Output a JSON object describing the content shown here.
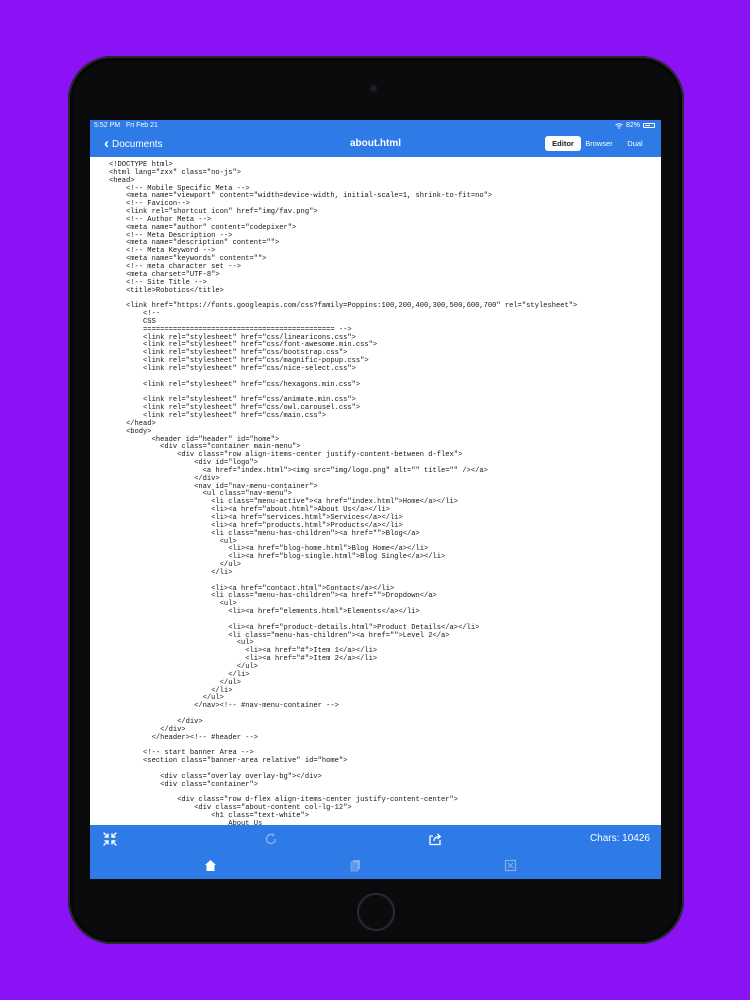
{
  "status_bar": {
    "time": "5:52 PM",
    "date": "Fri Feb 21",
    "battery": "82%"
  },
  "nav_bar": {
    "back_label": "Documents",
    "title": "about.html",
    "modes": [
      {
        "label": "Editor",
        "active": true
      },
      {
        "label": "Browser",
        "active": false
      },
      {
        "label": "Dual",
        "active": false
      }
    ]
  },
  "editor": {
    "code_lines": [
      "<!DOCTYPE html>",
      "<html lang=\"zxx\" class=\"no-js\">",
      "<head>",
      "    <!-- Mobile Specific Meta -->",
      "    <meta name=\"viewport\" content=\"width=device-width, initial-scale=1, shrink-to-fit=no\">",
      "    <!-- Favicon-->",
      "    <link rel=\"shortcut icon\" href=\"img/fav.png\">",
      "    <!-- Author Meta -->",
      "    <meta name=\"author\" content=\"codepixer\">",
      "    <!-- Meta Description -->",
      "    <meta name=\"description\" content=\"\">",
      "    <!-- Meta Keyword -->",
      "    <meta name=\"keywords\" content=\"\">",
      "    <!-- meta character set -->",
      "    <meta charset=\"UTF-8\">",
      "    <!-- Site Title -->",
      "    <title>Robotics</title>",
      "",
      "    <link href=\"https://fonts.googleapis.com/css?family=Poppins:100,200,400,300,500,600,700\" rel=\"stylesheet\">",
      "        <!--",
      "        CSS",
      "        ============================================= -->",
      "        <link rel=\"stylesheet\" href=\"css/linearicons.css\">",
      "        <link rel=\"stylesheet\" href=\"css/font-awesome.min.css\">",
      "        <link rel=\"stylesheet\" href=\"css/bootstrap.css\">",
      "        <link rel=\"stylesheet\" href=\"css/magnific-popup.css\">",
      "        <link rel=\"stylesheet\" href=\"css/nice-select.css\">",
      "",
      "        <link rel=\"stylesheet\" href=\"css/hexagons.min.css\">",
      "",
      "        <link rel=\"stylesheet\" href=\"css/animate.min.css\">",
      "        <link rel=\"stylesheet\" href=\"css/owl.carousel.css\">",
      "        <link rel=\"stylesheet\" href=\"css/main.css\">",
      "    </head>",
      "    <body>",
      "          <header id=\"header\" id=\"home\">",
      "            <div class=\"container main-menu\">",
      "                <div class=\"row align-items-center justify-content-between d-flex\">",
      "                    <div id=\"logo\">",
      "                      <a href=\"index.html\"><img src=\"img/logo.png\" alt=\"\" title=\"\" /></a>",
      "                    </div>",
      "                    <nav id=\"nav-menu-container\">",
      "                      <ul class=\"nav-menu\">",
      "                        <li class=\"menu-active\"><a href=\"index.html\">Home</a></li>",
      "                        <li><a href=\"about.html\">About Us</a></li>",
      "                        <li><a href=\"services.html\">Services</a></li>",
      "                        <li><a href=\"products.html\">Products</a></li>",
      "                        <li class=\"menu-has-children\"><a href=\"\">Blog</a>",
      "                          <ul>",
      "                            <li><a href=\"blog-home.html\">Blog Home</a></li>",
      "                            <li><a href=\"blog-single.html\">Blog Single</a></li>",
      "                          </ul>",
      "                        </li>",
      "",
      "                        <li><a href=\"contact.html\">Contact</a></li>",
      "                        <li class=\"menu-has-children\"><a href=\"\">Dropdown</a>",
      "                          <ul>",
      "                            <li><a href=\"elements.html\">Elements</a></li>",
      "",
      "                            <li><a href=\"product-details.html\">Product Details</a></li>",
      "                            <li class=\"menu-has-children\"><a href=\"\">Level 2</a>",
      "                              <ul>",
      "                                <li><a href=\"#\">Item 1</a></li>",
      "                                <li><a href=\"#\">Item 2</a></li>",
      "                              </ul>",
      "                            </li>",
      "                          </ul>",
      "                        </li>",
      "                      </ul>",
      "                    </nav><!-- #nav-menu-container -->",
      "",
      "                </div>",
      "            </div>",
      "          </header><!-- #header -->",
      "",
      "        <!-- start banner Area -->",
      "        <section class=\"banner-area relative\" id=\"home\">",
      "",
      "            <div class=\"overlay overlay-bg\"></div>",
      "            <div class=\"container\">",
      "",
      "                <div class=\"row d-flex align-items-center justify-content-center\">",
      "                    <div class=\"about-content col-lg-12\">",
      "                        <h1 class=\"text-white\">",
      "                            About Us"
    ]
  },
  "toolbar": {
    "chars_label": "Chars: 10426",
    "icons": [
      "collapse-icon",
      "refresh-icon",
      "share-icon"
    ]
  },
  "tab_bar": {
    "icons": [
      "home-icon",
      "copy-icon",
      "close-icon"
    ]
  },
  "colors": {
    "background": "#8a12f5",
    "accent": "#2e7ae6"
  }
}
